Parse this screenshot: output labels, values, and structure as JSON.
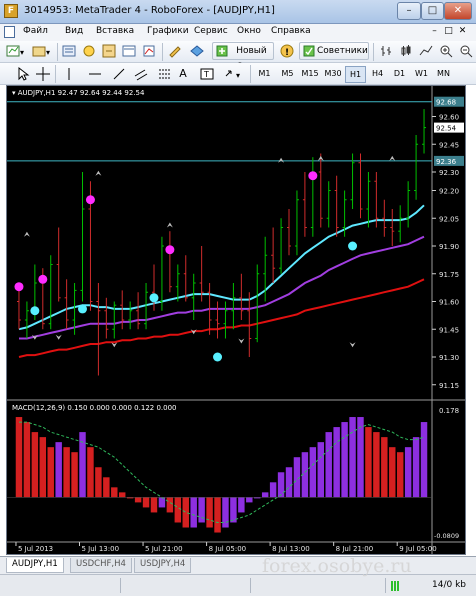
{
  "window": {
    "title": "3014953: MetaTrader 4 - RoboForex - [AUDJPY,H1]",
    "app_icon": "F",
    "controls": [
      "–",
      "□",
      "✕"
    ]
  },
  "menu": {
    "items": [
      "Файл",
      "Вид",
      "Вставка",
      "Графики",
      "Сервис",
      "Окно",
      "Справка"
    ],
    "mdi_controls": [
      "–",
      "□",
      "✕"
    ]
  },
  "toolbar1": {
    "new_order_label": "Новый Ордер",
    "advisors_label": "Советники"
  },
  "toolbar2": {
    "timeframes": [
      "M1",
      "M5",
      "M15",
      "M30",
      "H1",
      "H4",
      "D1",
      "W1",
      "MN"
    ],
    "active_timeframe": "H1",
    "tool_letters": [
      "A",
      "T"
    ]
  },
  "chart": {
    "header": "AUDJPY,H1  92.47 92.64 92.44 92.54",
    "price_labels": [
      "92.60",
      "92.45",
      "92.30",
      "92.20",
      "92.05",
      "91.90",
      "91.75",
      "91.60",
      "91.45",
      "91.30",
      "91.15"
    ],
    "highlight_labels": [
      {
        "text": "92.68",
        "bg": "#3c7f8d",
        "fg": "#ffffff"
      },
      {
        "text": "92.54",
        "bg": "#ffffff",
        "fg": "#000000"
      },
      {
        "text": "92.36",
        "bg": "#3c7f8d",
        "fg": "#ffffff"
      }
    ],
    "time_labels": [
      "5 Jul 2013",
      "5 Jul 13:00",
      "5 Jul 21:00",
      "8 Jul 05:00",
      "8 Jul 13:00",
      "8 Jul 21:00",
      "9 Jul 05:00"
    ],
    "macd_header": "MACD(12,26,9) 0.150 0.000 0.000 0.122 0.000",
    "macd_labels": [
      "0.178",
      "-0.0809"
    ],
    "colors": {
      "background": "#000000",
      "bull": "#00c000",
      "bear": "#d12c2c",
      "line_cyan": "#5fe8ff",
      "line_purple": "#a13ee0",
      "line_red": "#e01010",
      "marker_magenta": "#ff2cff",
      "marker_cyan": "#59f0ff",
      "macd_red": "#d52020",
      "macd_purple": "#8d2fe0",
      "macd_signal": "#2fb85b"
    }
  },
  "chart_data": {
    "type": "candlestick",
    "symbol": "AUDJPY",
    "timeframe": "H1",
    "ylim": [
      91.1,
      92.7
    ],
    "candles": [
      [
        91.6,
        91.7,
        91.45,
        91.5
      ],
      [
        91.5,
        91.6,
        91.4,
        91.55
      ],
      [
        91.55,
        91.8,
        91.5,
        91.7
      ],
      [
        91.7,
        91.78,
        91.45,
        91.48
      ],
      [
        91.48,
        91.85,
        91.45,
        91.8
      ],
      [
        91.8,
        92.0,
        91.6,
        91.62
      ],
      [
        91.62,
        91.72,
        91.45,
        91.5
      ],
      [
        91.5,
        91.7,
        91.42,
        91.66
      ],
      [
        91.66,
        92.3,
        91.6,
        92.1
      ],
      [
        92.1,
        92.25,
        91.55,
        91.6
      ],
      [
        91.6,
        91.7,
        91.2,
        91.55
      ],
      [
        91.55,
        91.62,
        91.4,
        91.45
      ],
      [
        91.45,
        91.6,
        91.4,
        91.58
      ],
      [
        91.58,
        91.66,
        91.45,
        91.5
      ],
      [
        91.5,
        91.6,
        91.45,
        91.55
      ],
      [
        91.55,
        91.65,
        91.45,
        91.48
      ],
      [
        91.48,
        91.7,
        91.45,
        91.65
      ],
      [
        91.65,
        91.8,
        91.55,
        91.6
      ],
      [
        91.6,
        91.95,
        91.55,
        91.9
      ],
      [
        91.9,
        91.98,
        91.65,
        91.68
      ],
      [
        91.68,
        91.8,
        91.6,
        91.75
      ],
      [
        91.75,
        91.85,
        91.6,
        91.62
      ],
      [
        91.62,
        91.75,
        91.5,
        91.7
      ],
      [
        91.7,
        91.9,
        91.6,
        91.65
      ],
      [
        91.65,
        91.7,
        91.42,
        91.5
      ],
      [
        91.5,
        91.6,
        91.4,
        91.48
      ],
      [
        91.48,
        91.6,
        91.4,
        91.55
      ],
      [
        91.55,
        91.7,
        91.45,
        91.62
      ],
      [
        91.62,
        91.75,
        91.5,
        91.55
      ],
      [
        91.55,
        91.65,
        91.3,
        91.4
      ],
      [
        91.4,
        91.8,
        91.38,
        91.75
      ],
      [
        91.75,
        91.95,
        91.6,
        91.85
      ],
      [
        91.85,
        92.0,
        91.7,
        91.78
      ],
      [
        91.78,
        92.05,
        91.75,
        92.0
      ],
      [
        92.0,
        92.1,
        91.85,
        91.9
      ],
      [
        91.9,
        92.2,
        91.85,
        92.15
      ],
      [
        92.15,
        92.3,
        91.95,
        92.0
      ],
      [
        92.0,
        92.38,
        91.95,
        92.3
      ],
      [
        92.3,
        92.4,
        92.0,
        92.05
      ],
      [
        92.05,
        92.25,
        92.0,
        92.2
      ],
      [
        92.2,
        92.28,
        91.95,
        92.0
      ],
      [
        92.0,
        92.2,
        91.95,
        92.15
      ],
      [
        92.15,
        92.4,
        92.1,
        92.35
      ],
      [
        92.35,
        92.4,
        92.05,
        92.1
      ],
      [
        92.1,
        92.3,
        92.0,
        92.25
      ],
      [
        92.25,
        92.3,
        92.0,
        92.05
      ],
      [
        92.05,
        92.15,
        91.95,
        92.0
      ],
      [
        92.0,
        92.1,
        91.9,
        91.98
      ],
      [
        91.98,
        92.12,
        91.92,
        92.05
      ],
      [
        92.05,
        92.25,
        92.0,
        92.2
      ],
      [
        92.2,
        92.5,
        92.15,
        92.45
      ],
      [
        92.45,
        92.64,
        92.4,
        92.54
      ]
    ],
    "ma_fast": [
      91.45,
      91.46,
      91.48,
      91.5,
      91.52,
      91.54,
      91.56,
      91.57,
      91.58,
      91.58,
      91.57,
      91.57,
      91.56,
      91.56,
      91.56,
      91.57,
      91.58,
      91.59,
      91.6,
      91.61,
      91.62,
      91.63,
      91.64,
      91.64,
      91.64,
      91.63,
      91.62,
      91.61,
      91.61,
      91.61,
      91.63,
      91.66,
      91.7,
      91.74,
      91.78,
      91.82,
      91.86,
      91.89,
      91.92,
      91.95,
      91.97,
      91.99,
      92.01,
      92.02,
      92.03,
      92.04,
      92.04,
      92.04,
      92.04,
      92.05,
      92.08,
      92.12
    ],
    "ma_mid": [
      91.4,
      91.4,
      91.41,
      91.42,
      91.43,
      91.44,
      91.45,
      91.46,
      91.47,
      91.48,
      91.48,
      91.48,
      91.48,
      91.49,
      91.49,
      91.5,
      91.5,
      91.51,
      91.52,
      91.53,
      91.54,
      91.54,
      91.55,
      91.55,
      91.56,
      91.56,
      91.56,
      91.56,
      91.56,
      91.56,
      91.57,
      91.58,
      91.6,
      91.62,
      91.64,
      91.67,
      91.7,
      91.72,
      91.74,
      91.77,
      91.79,
      91.81,
      91.83,
      91.85,
      91.86,
      91.87,
      91.88,
      91.89,
      91.9,
      91.91,
      91.93,
      91.95
    ],
    "ma_slow": [
      91.3,
      91.31,
      91.31,
      91.32,
      91.33,
      91.34,
      91.34,
      91.35,
      91.36,
      91.37,
      91.37,
      91.38,
      91.38,
      91.39,
      91.39,
      91.4,
      91.4,
      91.41,
      91.41,
      91.42,
      91.42,
      91.43,
      91.44,
      91.44,
      91.45,
      91.45,
      91.46,
      91.46,
      91.47,
      91.47,
      91.48,
      91.49,
      91.5,
      91.51,
      91.52,
      91.53,
      91.55,
      91.56,
      91.57,
      91.58,
      91.59,
      91.6,
      91.61,
      91.62,
      91.63,
      91.64,
      91.65,
      91.66,
      91.67,
      91.68,
      91.7,
      91.72
    ],
    "markers_magenta": [
      [
        0,
        91.68
      ],
      [
        3,
        91.72
      ],
      [
        9,
        92.15
      ],
      [
        19,
        91.88
      ],
      [
        37,
        92.28
      ]
    ],
    "markers_cyan": [
      [
        2,
        91.55
      ],
      [
        8,
        91.56
      ],
      [
        17,
        91.62
      ],
      [
        25,
        91.3
      ],
      [
        42,
        91.9
      ]
    ],
    "arrows_up": [
      [
        2,
        91.42
      ],
      [
        5,
        91.42
      ],
      [
        12,
        91.38
      ],
      [
        22,
        91.45
      ],
      [
        28,
        91.4
      ],
      [
        42,
        91.38
      ]
    ],
    "arrows_down": [
      [
        1,
        91.95
      ],
      [
        10,
        92.28
      ],
      [
        19,
        92.0
      ],
      [
        33,
        92.35
      ],
      [
        38,
        92.36
      ],
      [
        47,
        92.36
      ]
    ],
    "macd_ylim": [
      -0.0809,
      0.178
    ],
    "macd_hist": [
      0.16,
      0.15,
      0.13,
      0.12,
      0.1,
      0.11,
      0.1,
      0.09,
      0.13,
      0.1,
      0.06,
      0.04,
      0.02,
      0.01,
      0.0,
      -0.01,
      -0.02,
      -0.03,
      -0.02,
      -0.03,
      -0.05,
      -0.06,
      -0.06,
      -0.05,
      -0.06,
      -0.07,
      -0.06,
      -0.05,
      -0.03,
      -0.01,
      0.0,
      0.01,
      0.03,
      0.05,
      0.06,
      0.08,
      0.09,
      0.1,
      0.11,
      0.13,
      0.14,
      0.15,
      0.16,
      0.16,
      0.14,
      0.13,
      0.12,
      0.1,
      0.09,
      0.1,
      0.12,
      0.15
    ],
    "macd_signal": [
      0.15,
      0.15,
      0.145,
      0.14,
      0.13,
      0.125,
      0.12,
      0.115,
      0.11,
      0.105,
      0.1,
      0.09,
      0.08,
      0.065,
      0.05,
      0.035,
      0.02,
      0.01,
      0.0,
      -0.01,
      -0.02,
      -0.03,
      -0.035,
      -0.04,
      -0.045,
      -0.05,
      -0.05,
      -0.045,
      -0.04,
      -0.035,
      -0.025,
      -0.015,
      -0.005,
      0.005,
      0.02,
      0.035,
      0.05,
      0.065,
      0.08,
      0.095,
      0.11,
      0.12,
      0.13,
      0.14,
      0.145,
      0.14,
      0.135,
      0.13,
      0.12,
      0.115,
      0.115,
      0.12
    ]
  },
  "tabs": [
    "AUDJPY,H1",
    "USDCHF,H4",
    "USDJPY,H4"
  ],
  "status": {
    "traffic": "14/0 kb",
    "watermark": "forex.osobye.ru"
  }
}
